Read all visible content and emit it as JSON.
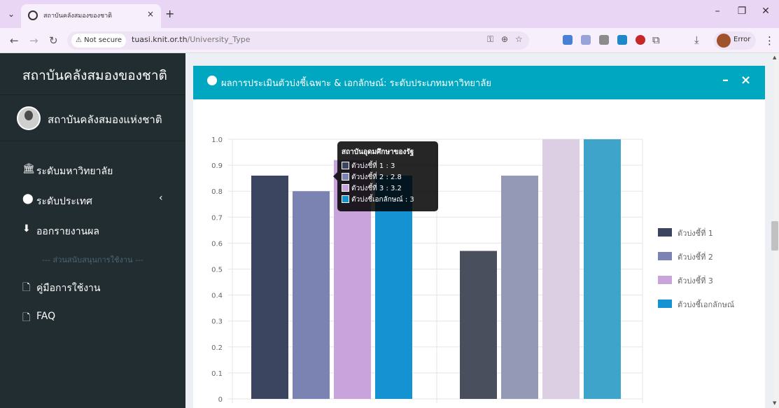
{
  "browser": {
    "tab_title": "สถาบันคลังสมองของชาติ",
    "tab_close": "×",
    "new_tab": "+",
    "security_label": "⚠ Not secure",
    "url_host": "tuasi.knit.or.th",
    "url_path": "/University_Type",
    "profile_label": "Error"
  },
  "sidebar": {
    "brand": "สถาบันคลังสมองของชาติ",
    "user_name": "สถาบันคลังสมองแห่งชาติ",
    "items": [
      {
        "icon": "university-icon",
        "glyph": "🏛",
        "label": "ระดับมหาวิทยาลัย"
      },
      {
        "icon": "globe-icon",
        "glyph": "⬤",
        "label": "ระดับประเทศ",
        "caret": "‹"
      },
      {
        "icon": "download-icon",
        "glyph": "⬇",
        "label": "ออกรายงานผล"
      }
    ],
    "section_header": "--- ส่วนสนับสนุนการใช้งาน ---",
    "support_items": [
      {
        "icon": "file-icon",
        "glyph": "🗋",
        "label": "คู่มือการใช้งาน"
      },
      {
        "icon": "file-icon",
        "glyph": "🗋",
        "label": "FAQ"
      }
    ]
  },
  "panel": {
    "title": "ผลการประเมินตัวบ่งชี้เฉพาะ & เอกลักษณ์: ระดับประเภทมหาวิทยาลัย",
    "collapse_label": "–",
    "close_label": "×"
  },
  "chart_data": {
    "type": "bar",
    "categories": [
      "",
      ""
    ],
    "series": [
      {
        "name": "ตัวบ่งชี้ที่ 1",
        "values": [
          0.86,
          0.57
        ],
        "color": "#3b4560"
      },
      {
        "name": "ตัวบ่งชี้ที่ 2",
        "values": [
          0.8,
          0.86
        ],
        "color": "#7b83b3"
      },
      {
        "name": "ตัวบ่งชี้ที่ 3",
        "values": [
          0.92,
          1.0
        ],
        "color": "#c9a3dc"
      },
      {
        "name": "ตัวบ่งชี้เอกลักษณ์",
        "values": [
          0.86,
          1.0
        ],
        "color": "#1492d2"
      }
    ],
    "series_colors_second_group": [
      "#4a4f5e",
      "#9499b5",
      "#dccfe3",
      "#3ea4c9"
    ],
    "yticks": [
      "1.0",
      "0.9",
      "0.8",
      "0.7",
      "0.6",
      "0.5",
      "0.4",
      "0.3",
      "0.2",
      "0.1",
      "0"
    ],
    "ylim": [
      0,
      1.0
    ],
    "legend_position": "right",
    "grid": true
  },
  "tooltip": {
    "title": "สถาบันอุดมศึกษาของรัฐ",
    "rows": [
      {
        "text": "ตัวบ่งชี้ที่ 1 : 3",
        "color": "#3b4560"
      },
      {
        "text": "ตัวบ่งชี้ที่ 2 : 2.8",
        "color": "#7b83b3"
      },
      {
        "text": "ตัวบ่งชี้ที่ 3 : 3.2",
        "color": "#c9a3dc"
      },
      {
        "text": "ตัวบ่งชี้เอกลักษณ์ : 3",
        "color": "#1492d2"
      }
    ]
  }
}
